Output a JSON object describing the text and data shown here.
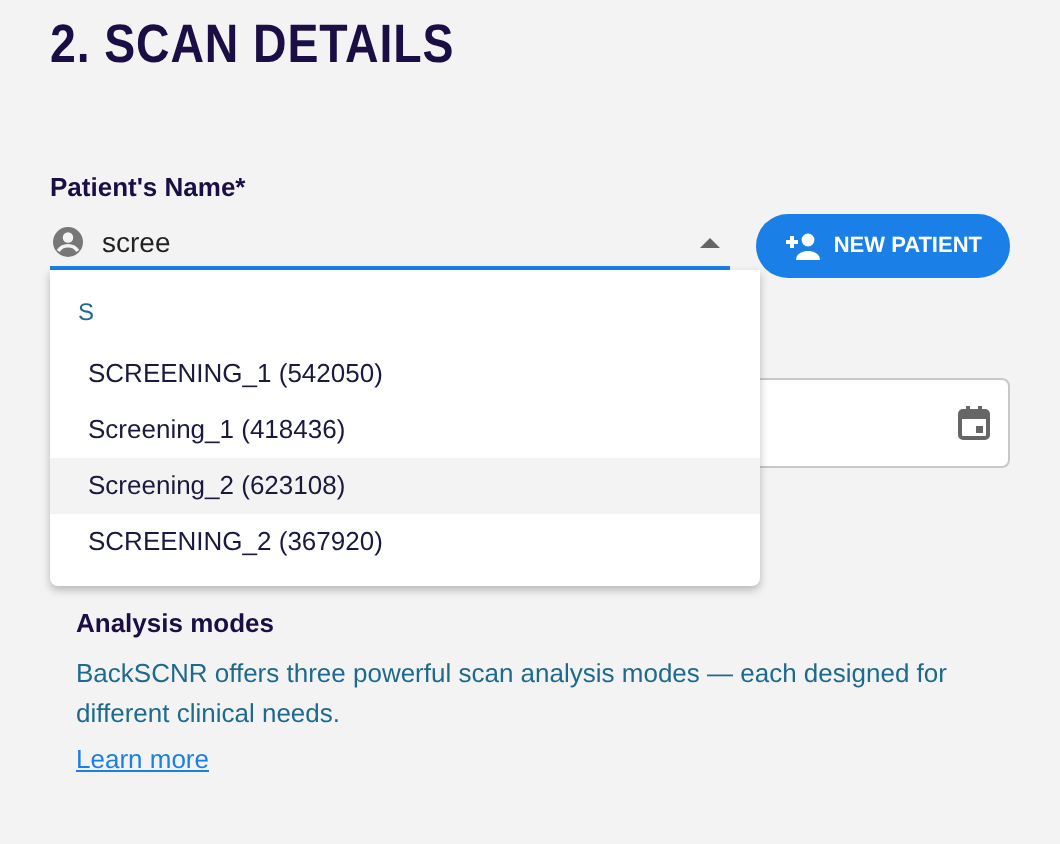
{
  "heading": "2. SCAN DETAILS",
  "patient_field": {
    "label": "Patient's Name*",
    "value": "scree",
    "expanded": true
  },
  "new_patient_button": {
    "label": "NEW PATIENT"
  },
  "dropdown": {
    "group_header": "S",
    "options": [
      {
        "label": "SCREENING_1 (542050)",
        "selected": false
      },
      {
        "label": "Screening_1 (418436)",
        "selected": false
      },
      {
        "label": "Screening_2 (623108)",
        "selected": true
      },
      {
        "label": "SCREENING_2 (367920)",
        "selected": false
      }
    ]
  },
  "analysis": {
    "title": "Analysis modes",
    "text": "BackSCNR offers three powerful scan analysis modes — each designed for different clinical needs.",
    "link": "Learn more"
  }
}
